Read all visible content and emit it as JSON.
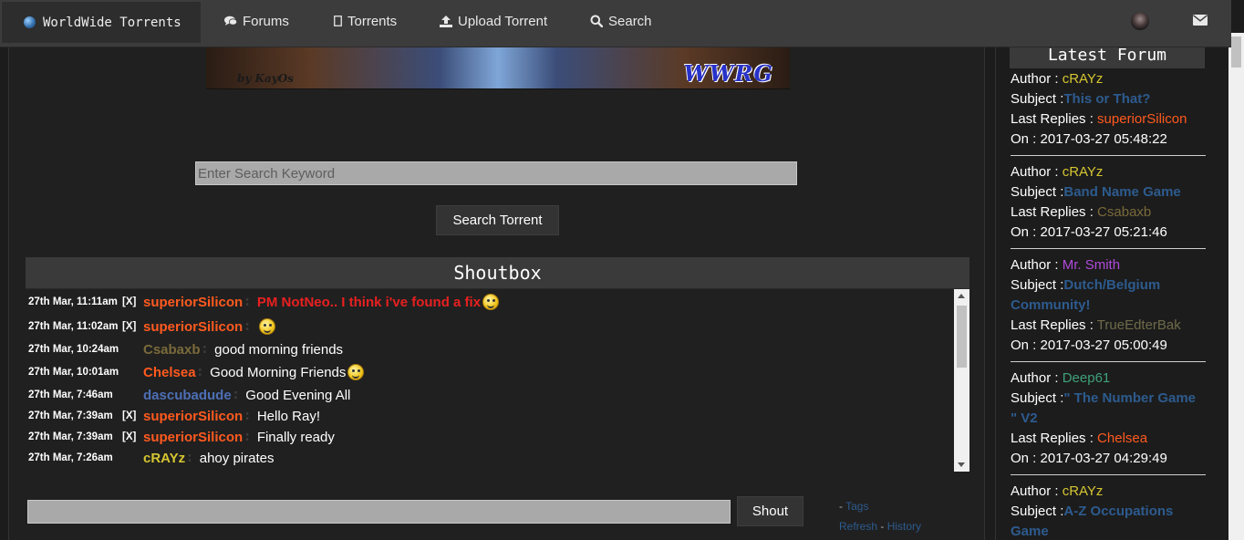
{
  "nav": {
    "brand": "WorldWide Torrents",
    "items": [
      {
        "label": "Forums",
        "icon": "comments-icon"
      },
      {
        "label": "Torrents",
        "icon": "file-icon"
      },
      {
        "label": "Upload Torrent",
        "icon": "upload-icon"
      },
      {
        "label": "Search",
        "icon": "search-icon"
      }
    ]
  },
  "banner": {
    "signature": "by KayOs",
    "logo": "WWRG"
  },
  "search": {
    "placeholder": "Enter Search Keyword",
    "button": "Search Torrent"
  },
  "shoutbox": {
    "title": "Shoutbox",
    "messages": [
      {
        "time": "27th Mar, 11:11am",
        "delete": "[X]",
        "user": "superiorSilicon",
        "user_color": "#ff5a1f",
        "text": "PM NotNeo.. I think i've found a fix",
        "red": true,
        "smiley": true
      },
      {
        "time": "27th Mar, 11:02am",
        "delete": "[X]",
        "user": "superiorSilicon",
        "user_color": "#ff5a1f",
        "text": "",
        "red": false,
        "smiley": true
      },
      {
        "time": "27th Mar, 10:24am",
        "delete": "",
        "user": "Csabaxb",
        "user_color": "#7a6a3a",
        "text": "good morning friends",
        "red": false,
        "smiley": false
      },
      {
        "time": "27th Mar, 10:01am",
        "delete": "",
        "user": "Chelsea",
        "user_color": "#ff5a1f",
        "text": "Good Morning Friends",
        "red": false,
        "smiley": true
      },
      {
        "time": "27th Mar, 7:46am",
        "delete": "",
        "user": "dascubadude",
        "user_color": "#4d6fb5",
        "text": "Good Evening All",
        "red": false,
        "smiley": false
      },
      {
        "time": "27th Mar, 7:39am",
        "delete": "[X]",
        "user": "superiorSilicon",
        "user_color": "#ff5a1f",
        "text": "Hello Ray!",
        "red": false,
        "smiley": false
      },
      {
        "time": "27th Mar, 7:39am",
        "delete": "[X]",
        "user": "superiorSilicon",
        "user_color": "#ff5a1f",
        "text": "Finally ready",
        "red": false,
        "smiley": false
      },
      {
        "time": "27th Mar, 7:26am",
        "delete": "",
        "user": "cRAYz",
        "user_color": "#d6c631",
        "text": "ahoy pirates",
        "red": false,
        "smiley": false
      }
    ],
    "shout_button": "Shout",
    "links": {
      "tags": "Tags",
      "refresh": "Refresh",
      "history": "History"
    }
  },
  "latest_forum": {
    "title": "Latest Forum",
    "labels": {
      "author": "Author : ",
      "subject": "Subject :",
      "last_replies": "Last Replies : ",
      "on": "On : "
    },
    "entries": [
      {
        "author": "cRAYz",
        "author_color": "#d6c631",
        "subject": "This or That?",
        "last_reply": "superiorSilicon",
        "last_reply_color": "#ff5a1f",
        "on": "2017-03-27 05:48:22"
      },
      {
        "author": "cRAYz",
        "author_color": "#d6c631",
        "subject": "Band Name Game",
        "last_reply": "Csabaxb",
        "last_reply_color": "#7a6a3a",
        "on": "2017-03-27 05:21:46"
      },
      {
        "author": "Mr. Smith",
        "author_color": "#b04ad8",
        "subject": "Dutch/Belgium Community!",
        "last_reply": "TrueEdterBak",
        "last_reply_color": "#6e6a4a",
        "on": "2017-03-27 05:00:49"
      },
      {
        "author": "Deep61",
        "author_color": "#3fa07a",
        "subject": "\" The Number Game \" V2",
        "last_reply": "Chelsea",
        "last_reply_color": "#ff5a1f",
        "on": "2017-03-27 04:29:49"
      },
      {
        "author": "cRAYz",
        "author_color": "#d6c631",
        "subject": "A-Z Occupations Game",
        "last_reply": "",
        "last_reply_color": "#ff5a1f",
        "on": ""
      }
    ]
  }
}
